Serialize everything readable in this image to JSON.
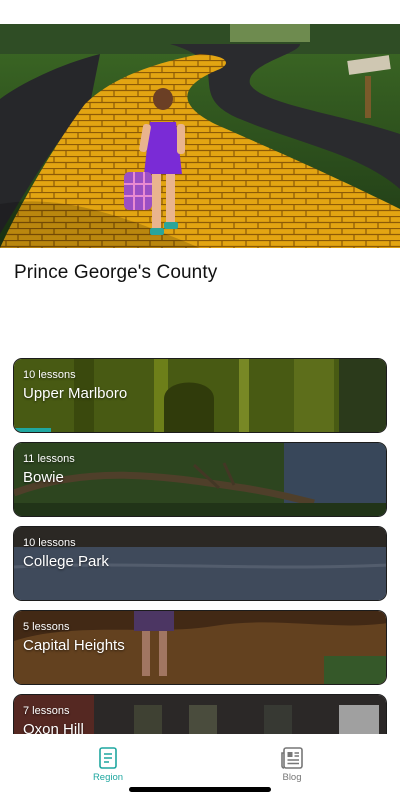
{
  "header": {
    "title": "Prince George's County"
  },
  "regions": [
    {
      "lessons": "10 lessons",
      "name": "Upper Marlboro",
      "progress_fraction": 0.1
    },
    {
      "lessons": "11 lessons",
      "name": "Bowie"
    },
    {
      "lessons": "10 lessons",
      "name": "College Park"
    },
    {
      "lessons": "5 lessons",
      "name": "Capital Heights"
    },
    {
      "lessons": "7 lessons",
      "name": "Oxon Hill"
    }
  ],
  "tabbar": {
    "items": [
      {
        "label": "Region",
        "icon": "document-icon",
        "active": true
      },
      {
        "label": "Blog",
        "icon": "newspaper-icon",
        "active": false
      }
    ]
  },
  "colors": {
    "accent": "#1fa7a0",
    "inactive_tab": "#777777"
  }
}
